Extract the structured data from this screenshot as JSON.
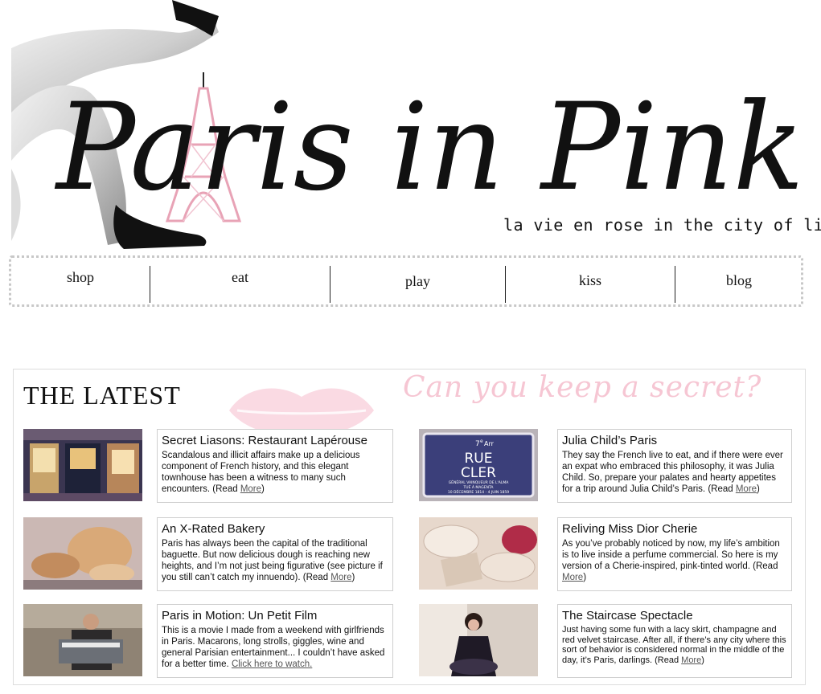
{
  "header": {
    "logo_text": "Paris in Pink",
    "tagline": "la vie en rose in the city of light"
  },
  "nav": {
    "items": [
      {
        "label": "shop"
      },
      {
        "label": "eat"
      },
      {
        "label": "play"
      },
      {
        "label": "kiss"
      },
      {
        "label": "blog"
      }
    ]
  },
  "latest": {
    "title": "THE LATEST",
    "overlay_text": "Can you keep a secret?",
    "posts": [
      {
        "title": "Secret Liasons: Restaurant Lapérouse",
        "body": "Scandalous and illicit affairs make up a delicious component of French history, and this elegant townhouse has been a witness to many such encounters. (Read ",
        "link": "More",
        "suffix": ")"
      },
      {
        "title": "Julia Child’s Paris",
        "body": "They say the French live to eat, and if there were ever an expat who embraced this philosophy, it was Julia Child. So, prepare your palates and hearty appetites for a trip around Julia Child’s Paris. (Read ",
        "link": "More",
        "suffix": ")"
      },
      {
        "title": "An X-Rated Bakery",
        "body": "Paris has always been the capital of the traditional baguette. But now delicious dough is reaching new heights, and I’m not just being figurative (see picture if you still can’t catch my innuendo). (Read ",
        "link": "More",
        "suffix": ")"
      },
      {
        "title": "Reliving Miss Dior Cherie",
        "body": "As you’ve probably noticed by now, my life’s ambition is to live inside a perfume commercial. So here is my version of a Cherie-inspired, pink-tinted world. (Read ",
        "link": "More",
        "suffix": ")"
      },
      {
        "title": "Paris in Motion: Un Petit Film",
        "body": "This is a movie I made from a weekend with girlfriends in Paris. Macarons, long strolls, giggles, wine and general Parisian entertainment... I couldn’t have asked for a better time. ",
        "link": "Click here to watch.",
        "suffix": ""
      },
      {
        "title": "The Staircase Spectacle",
        "body": "Just having some fun with a lacy skirt, champagne and red velvet staircase. After all, if there’s any city where this sort of behavior is considered normal in the middle of the day, it’s Paris, darlings. (Read ",
        "link": "More",
        "suffix": ")"
      }
    ],
    "street_sign": {
      "arrondissement": "7",
      "arr_suffix": "e",
      "arr_label": "Arr",
      "line1": "RUE",
      "line2": "CLER",
      "sub1": "GÉNÉRAL VAINQUEUR DE L'ALMA",
      "sub2": "TUÉ À MAGENTA",
      "sub3": "10 DÉCEMBRE 1814 - 4 JUIN 1859"
    }
  },
  "colors": {
    "pink_light": "#f6c6d3",
    "pink_tower": "#e8a3b6",
    "border": "#cfcfcf",
    "text": "#111111"
  }
}
